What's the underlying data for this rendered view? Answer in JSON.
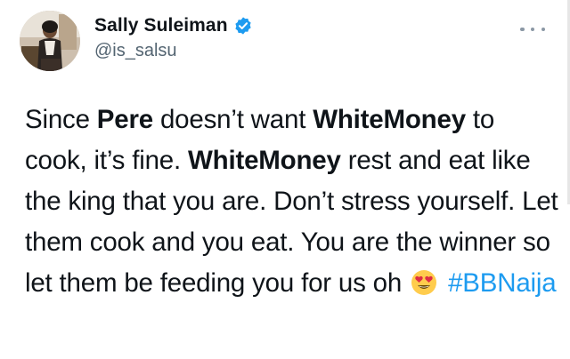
{
  "user": {
    "display_name": "Sally Suleiman",
    "handle": "@is_salsu",
    "verified": true,
    "avatar": "avatar-photo"
  },
  "tweet": {
    "segments": [
      {
        "text": "Since ",
        "bold": false
      },
      {
        "text": "Pere",
        "bold": true
      },
      {
        "text": " doesn’t want ",
        "bold": false
      },
      {
        "text": "WhiteMoney",
        "bold": true
      },
      {
        "text": " to cook, it’s fine. ",
        "bold": false
      },
      {
        "text": "WhiteMoney",
        "bold": true
      },
      {
        "text": " rest and eat like the king that you are. Don’t stress yourself. Let them cook and you eat. You are the winner so let them be feeding you for us oh ",
        "bold": false
      }
    ],
    "emoji": "smiling-face-with-heart-eyes",
    "hashtag": "#BBNaija"
  },
  "icons": {
    "verified": "verified-badge-icon",
    "more": "more-options-icon"
  },
  "colors": {
    "accent": "#1d9bf0",
    "text": "#0f1419",
    "secondary": "#536471"
  }
}
